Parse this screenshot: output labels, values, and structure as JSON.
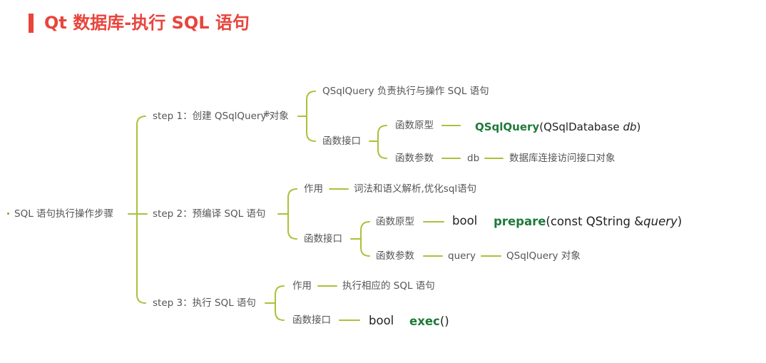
{
  "title": "Qt 数据库-执行 SQL 语句",
  "colors": {
    "accent_red": "#e8453c",
    "branch_green": "#a8c23a",
    "function_green": "#1f7a3a",
    "text_gray": "#555555"
  },
  "mindmap": {
    "root": "SQL 语句执行操作步骤",
    "steps": [
      {
        "label": "step 1：创建 QSqlQuery 对象",
        "purpose": "QSqlQuery 负责执行与操作 SQL 语句",
        "interface_label": "函数接口",
        "prototype_label": "函数原型",
        "prototype": {
          "func": "QSqlQuery",
          "open": "(QSqlDatabase ",
          "param": "db",
          "close": ")"
        },
        "params_label": "函数参数",
        "param_name": "db",
        "param_desc": "数据库连接访问接口对象"
      },
      {
        "label": "step 2：预编译 SQL 语句",
        "purpose_label": "作用",
        "purpose": "词法和语义解析,优化sql语句",
        "interface_label": "函数接口",
        "prototype_label": "函数原型",
        "return_type": "bool",
        "prototype": {
          "func": "prepare",
          "open": "(const QString &",
          "param": "query",
          "close": ")"
        },
        "params_label": "函数参数",
        "param_name": "query",
        "param_desc": "QSqlQuery 对象"
      },
      {
        "label": "step 3：执行 SQL 语句",
        "purpose_label": "作用",
        "purpose": "执行相应的 SQL 语句",
        "interface_label": "函数接口",
        "return_type": "bool",
        "prototype": {
          "func": "exec",
          "close": "()"
        }
      }
    ]
  }
}
